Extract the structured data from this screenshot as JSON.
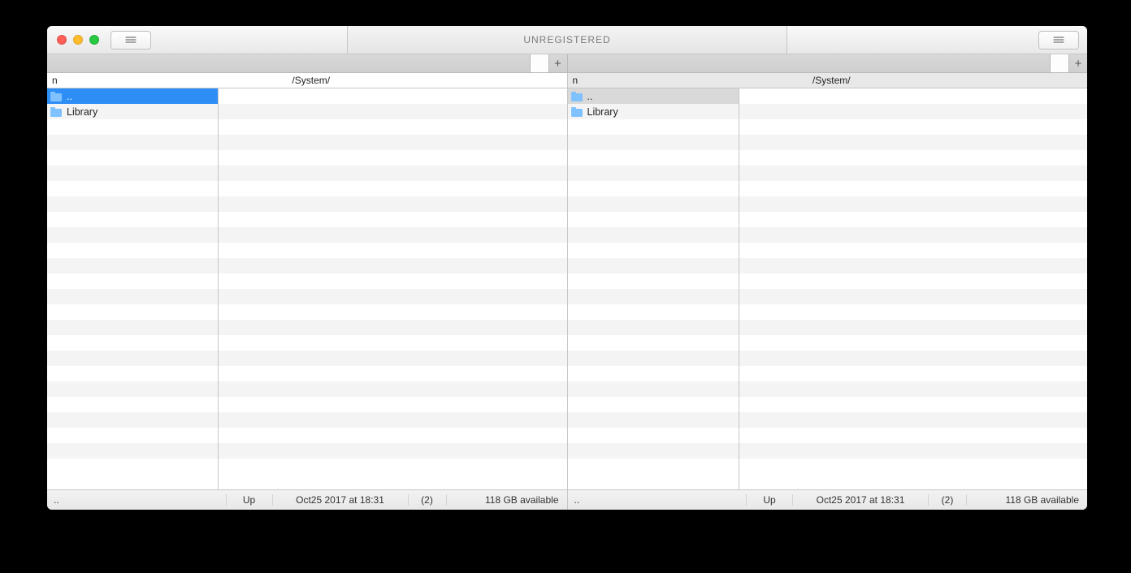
{
  "window": {
    "title": "UNREGISTERED"
  },
  "left": {
    "sort_indicator": "n",
    "path": "/System/",
    "items": [
      {
        "name": "..",
        "kind": "system",
        "selected": true
      },
      {
        "name": "Library",
        "kind": "folder",
        "selected": false
      }
    ],
    "status": {
      "name": "..",
      "up": "Up",
      "date": "Oct25 2017 at 18:31",
      "count": "(2)",
      "free": "118 GB available"
    }
  },
  "right": {
    "sort_indicator": "n",
    "path": "/System/",
    "items": [
      {
        "name": "..",
        "kind": "system",
        "selected": true
      },
      {
        "name": "Library",
        "kind": "folder",
        "selected": false
      }
    ],
    "status": {
      "name": "..",
      "up": "Up",
      "date": "Oct25 2017 at 18:31",
      "count": "(2)",
      "free": "118 GB available"
    }
  }
}
